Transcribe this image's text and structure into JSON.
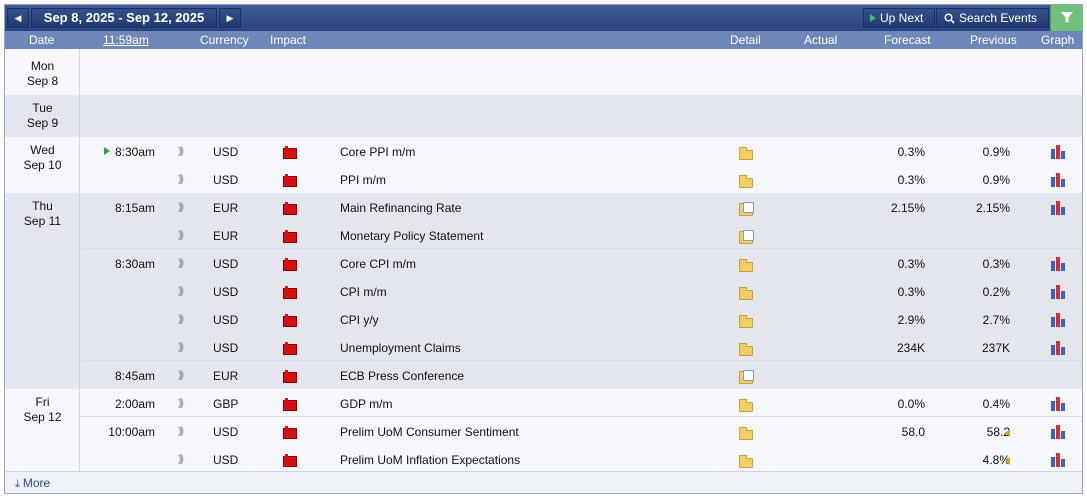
{
  "toolbar": {
    "prev_label": "◀",
    "next_label": "▶",
    "date_range": "Sep 8, 2025 - Sep 12, 2025",
    "up_next_label": "Up Next",
    "search_events_label": "Search Events"
  },
  "columns": {
    "date": "Date",
    "time": "11:59am",
    "currency": "Currency",
    "impact": "Impact",
    "detail": "Detail",
    "actual": "Actual",
    "forecast": "Forecast",
    "previous": "Previous",
    "graph": "Graph"
  },
  "days": {
    "mon": {
      "dow": "Mon",
      "date": "Sep 8"
    },
    "tue": {
      "dow": "Tue",
      "date": "Sep 9"
    },
    "wed": {
      "dow": "Wed",
      "date": "Sep 10"
    },
    "thu": {
      "dow": "Thu",
      "date": "Sep 11"
    },
    "fri": {
      "dow": "Fri",
      "date": "Sep 12"
    }
  },
  "events": [
    {
      "time": "8:30am",
      "currency": "USD",
      "name": "Core PPI m/m",
      "forecast": "0.3%",
      "previous": "0.9%",
      "detail": "folder",
      "graph": true,
      "upnext": true
    },
    {
      "time": "",
      "currency": "USD",
      "name": "PPI m/m",
      "forecast": "0.3%",
      "previous": "0.9%",
      "detail": "folder",
      "graph": true
    },
    {
      "time": "8:15am",
      "currency": "EUR",
      "name": "Main Refinancing Rate",
      "forecast": "2.15%",
      "previous": "2.15%",
      "detail": "doc",
      "graph": true
    },
    {
      "time": "",
      "currency": "EUR",
      "name": "Monetary Policy Statement",
      "forecast": "",
      "previous": "",
      "detail": "doc",
      "graph": false
    },
    {
      "time": "8:30am",
      "currency": "USD",
      "name": "Core CPI m/m",
      "forecast": "0.3%",
      "previous": "0.3%",
      "detail": "folder",
      "graph": true
    },
    {
      "time": "",
      "currency": "USD",
      "name": "CPI m/m",
      "forecast": "0.3%",
      "previous": "0.2%",
      "detail": "folder",
      "graph": true
    },
    {
      "time": "",
      "currency": "USD",
      "name": "CPI y/y",
      "forecast": "2.9%",
      "previous": "2.7%",
      "detail": "folder",
      "graph": true
    },
    {
      "time": "",
      "currency": "USD",
      "name": "Unemployment Claims",
      "forecast": "234K",
      "previous": "237K",
      "detail": "folder",
      "graph": true
    },
    {
      "time": "8:45am",
      "currency": "EUR",
      "name": "ECB Press Conference",
      "forecast": "",
      "previous": "",
      "detail": "doc",
      "graph": false
    },
    {
      "time": "2:00am",
      "currency": "GBP",
      "name": "GDP m/m",
      "forecast": "0.0%",
      "previous": "0.4%",
      "detail": "folder",
      "graph": true
    },
    {
      "time": "10:00am",
      "currency": "USD",
      "name": "Prelim UoM Consumer Sentiment",
      "forecast": "58.0",
      "previous": "58.2",
      "detail": "folder",
      "graph": true,
      "revised": true
    },
    {
      "time": "",
      "currency": "USD",
      "name": "Prelim UoM Inflation Expectations",
      "forecast": "",
      "previous": "4.8%",
      "detail": "folder",
      "graph": true,
      "revised": true
    }
  ],
  "footer": {
    "more_label": "More"
  },
  "colors": {
    "impact_high": "#d51010",
    "filter": "#6fc07a",
    "header_bar": "#2b4582"
  }
}
